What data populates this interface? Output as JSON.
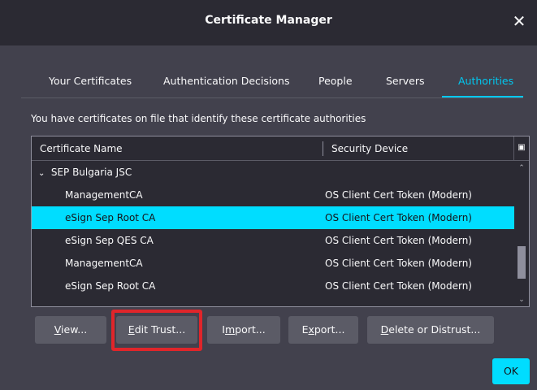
{
  "window": {
    "title": "Certificate Manager",
    "close_glyph": "✕",
    "close_icon": "close-icon"
  },
  "tabs": [
    {
      "label": "Your Certificates",
      "active": false
    },
    {
      "label": "Authentication Decisions",
      "active": false
    },
    {
      "label": "People",
      "active": false
    },
    {
      "label": "Servers",
      "active": false
    },
    {
      "label": "Authorities",
      "active": true
    }
  ],
  "description": "You have certificates on file that identify these certificate authorities",
  "table": {
    "columns": {
      "name": "Certificate Name",
      "device": "Security Device",
      "picker_icon": "column-picker-icon",
      "picker_glyph": "▣"
    },
    "group": {
      "label": "SEP Bulgaria JSC",
      "twisty_glyph": "⌄",
      "twisty_icon": "chevron-down-icon"
    },
    "rows": [
      {
        "name": "ManagementCA",
        "device": "OS Client Cert Token (Modern)",
        "selected": false
      },
      {
        "name": "eSign Sep Root CA",
        "device": "OS Client Cert Token (Modern)",
        "selected": true
      },
      {
        "name": "eSign Sep QES CA",
        "device": "OS Client Cert Token (Modern)",
        "selected": false
      },
      {
        "name": "ManagementCA",
        "device": "OS Client Cert Token (Modern)",
        "selected": false
      },
      {
        "name": "eSign Sep Root CA",
        "device": "OS Client Cert Token (Modern)",
        "selected": false
      }
    ],
    "scroll_up_glyph": "⌃",
    "scroll_down_glyph": "⌄"
  },
  "buttons": {
    "view": {
      "accesskey": "V",
      "rest": "iew..."
    },
    "edit_trust": {
      "accesskey": "E",
      "rest": "dit Trust..."
    },
    "import": {
      "pre": "I",
      "accesskey": "m",
      "rest": "port..."
    },
    "export": {
      "pre": "E",
      "accesskey": "x",
      "rest": "port..."
    },
    "delete": {
      "accesskey": "D",
      "rest": "elete or Distrust..."
    },
    "ok": "OK"
  },
  "colors": {
    "accent": "#00ddff",
    "highlight_box": "#e0252a",
    "dialog_bg": "#42414d"
  }
}
